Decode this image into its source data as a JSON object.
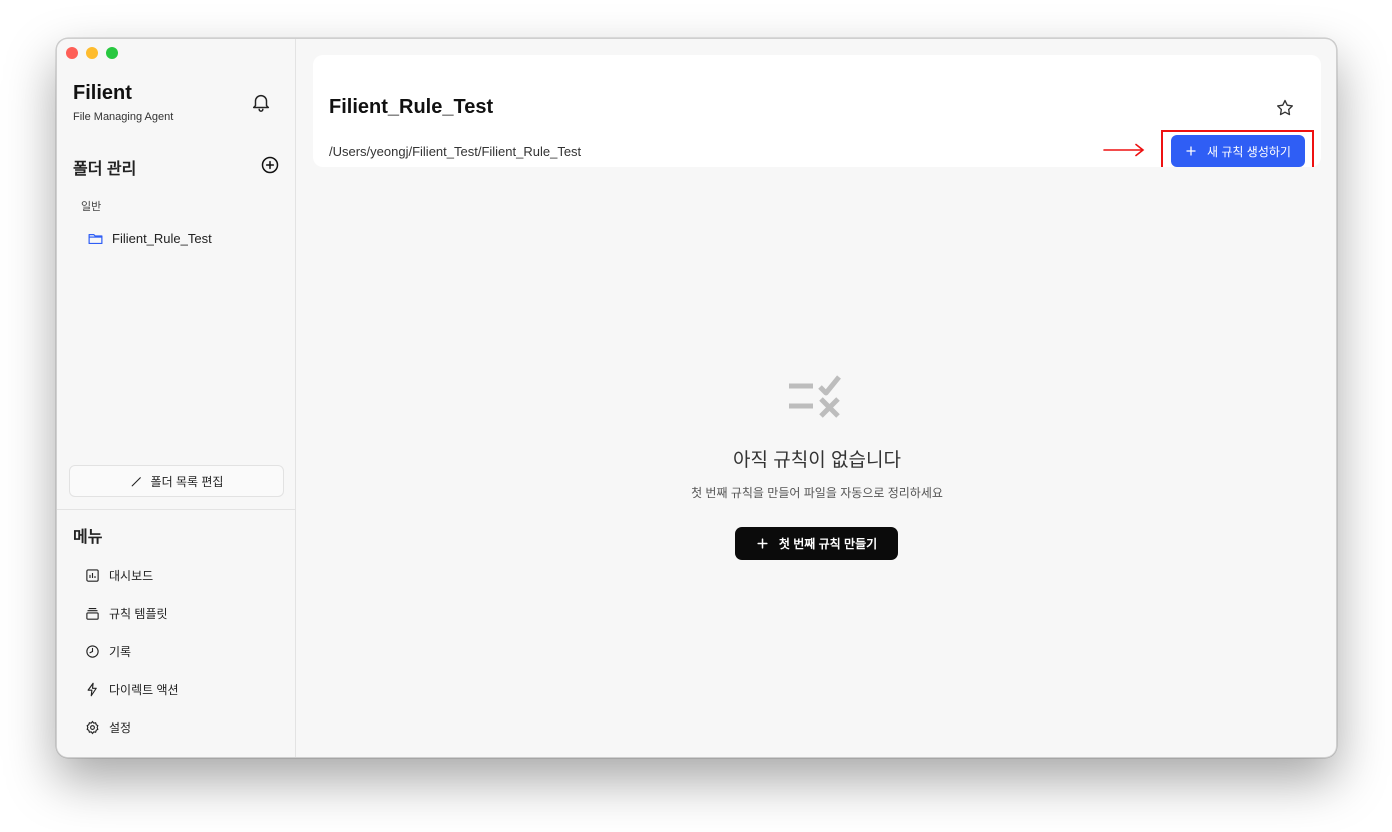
{
  "app": {
    "name": "Filient",
    "subtitle": "File Managing Agent"
  },
  "sidebar": {
    "folders_title": "폴더 관리",
    "group_label": "일반",
    "folders": [
      {
        "label": "Filient_Rule_Test",
        "icon": "folder-icon"
      }
    ],
    "edit_button": "폴더 목록 편집",
    "menu_title": "메뉴",
    "menu_items": [
      {
        "label": "대시보드",
        "icon": "chart-icon"
      },
      {
        "label": "규칙 템플릿",
        "icon": "template-icon"
      },
      {
        "label": "기록",
        "icon": "clock-icon"
      },
      {
        "label": "다이렉트 액션",
        "icon": "bolt-icon"
      },
      {
        "label": "설정",
        "icon": "gear-icon"
      }
    ]
  },
  "header": {
    "title": "Filient_Rule_Test",
    "path": "/Users/yeongj/Filient_Test/Filient_Rule_Test",
    "new_rule_button": "새 규칙 생성하기"
  },
  "empty_state": {
    "title": "아직 규칙이 없습니다",
    "subtitle": "첫 번째 규칙을 만들어 파일을 자동으로 정리하세요",
    "button": "첫 번째 규칙 만들기"
  },
  "colors": {
    "accent": "#2f5ef5",
    "annotation": "#e11111",
    "dark_button": "#0b0b0b"
  }
}
